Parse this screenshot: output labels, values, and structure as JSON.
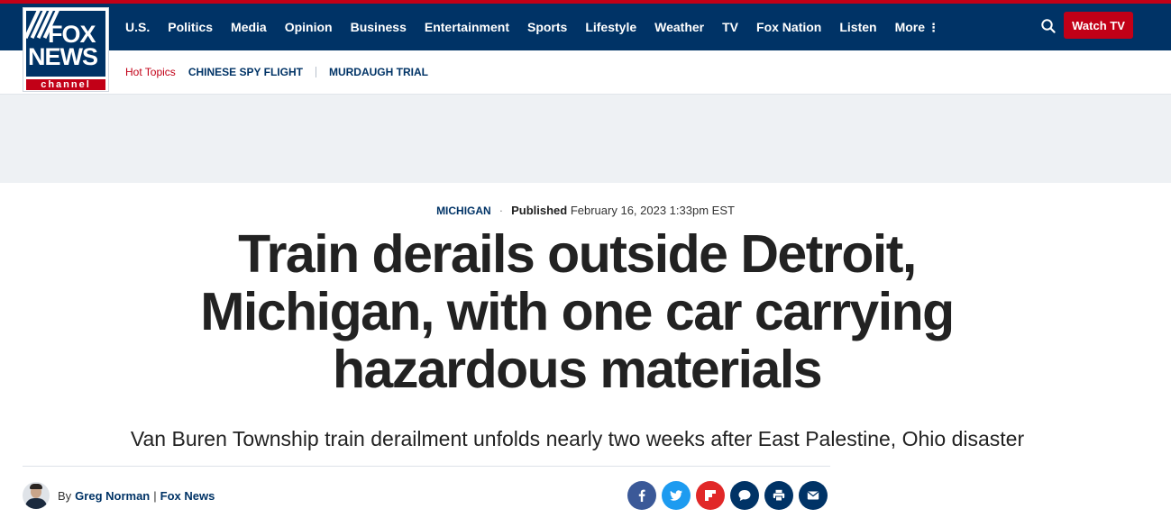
{
  "logo": {
    "fox": "FOX",
    "news": "NEWS",
    "channel": "channel",
    "colors": {
      "navy": "#003366",
      "red": "#c20017"
    }
  },
  "nav": {
    "items": [
      "U.S.",
      "Politics",
      "Media",
      "Opinion",
      "Business",
      "Entertainment",
      "Sports",
      "Lifestyle",
      "Weather",
      "TV",
      "Fox Nation",
      "Listen",
      "More"
    ],
    "search_icon": "search-icon",
    "watch_tv_label": "Watch TV"
  },
  "subnav": {
    "hot_topics_label": "Hot Topics",
    "topics": [
      "CHINESE SPY FLIGHT",
      "MURDAUGH TRIAL"
    ]
  },
  "article": {
    "category": "MICHIGAN",
    "published_label": "Published",
    "published_date": "February 16, 2023 1:33pm EST",
    "headline": "Train derails outside Detroit, Michigan, with one car carrying hazardous materials",
    "subheadline": "Van Buren Township train derailment unfolds nearly two weeks after East Palestine, Ohio disaster",
    "byline": {
      "by": "By",
      "author": "Greg Norman",
      "separator": "|",
      "outlet": "Fox News"
    }
  },
  "share": [
    {
      "icon": "facebook-icon",
      "color": "#3b5998"
    },
    {
      "icon": "twitter-icon",
      "color": "#1d9bf0"
    },
    {
      "icon": "flipboard-icon",
      "color": "#e12828"
    },
    {
      "icon": "comment-icon",
      "color": "#003366"
    },
    {
      "icon": "print-icon",
      "color": "#003366"
    },
    {
      "icon": "email-icon",
      "color": "#003366"
    }
  ]
}
